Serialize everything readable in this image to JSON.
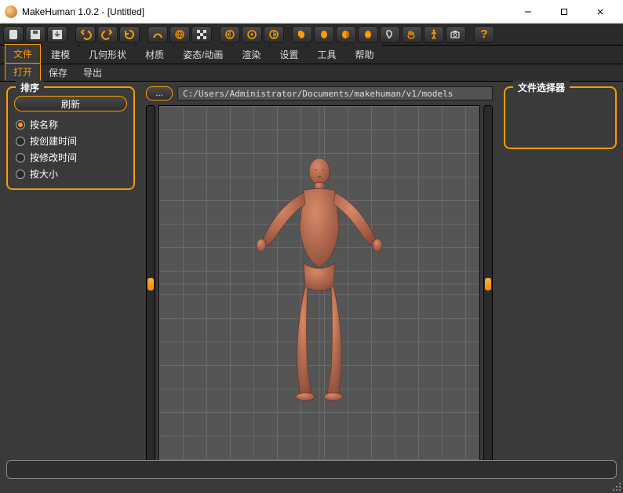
{
  "window": {
    "title": "MakeHuman 1.0.2 - [Untitled]"
  },
  "toolbar_icons": [
    "new-file-icon",
    "save-icon",
    "export-icon",
    "undo-icon",
    "redo-icon",
    "refresh-icon",
    "pose-icon",
    "globe-icon",
    "checker-icon",
    "camera-left-icon",
    "camera-front-icon",
    "camera-right-icon",
    "head-side-icon",
    "head-front-icon",
    "head-34-icon",
    "head-back-icon",
    "ear-icon",
    "hands-icon",
    "body-icon",
    "camera-icon",
    "help-icon"
  ],
  "tabs": {
    "main": [
      "文件",
      "建模",
      "几何形状",
      "材质",
      "姿态/动画",
      "渲染",
      "设置",
      "工具",
      "帮助"
    ],
    "main_active": 0,
    "sub": [
      "打开",
      "保存",
      "导出"
    ],
    "sub_active": 0
  },
  "left_panel": {
    "sort_legend": "排序",
    "refresh_label": "刷新",
    "sort_options": [
      "按名称",
      "按创建时间",
      "按修改时间",
      "按大小"
    ],
    "sort_selected": 0
  },
  "right_panel": {
    "selector_legend": "文件选择器"
  },
  "pathbar": {
    "up_label": "...",
    "path_value": "C:/Users/Administrator/Documents/makehuman/v1/models"
  },
  "colors": {
    "accent": "#ff9a00",
    "bg": "#3a3a3a"
  }
}
